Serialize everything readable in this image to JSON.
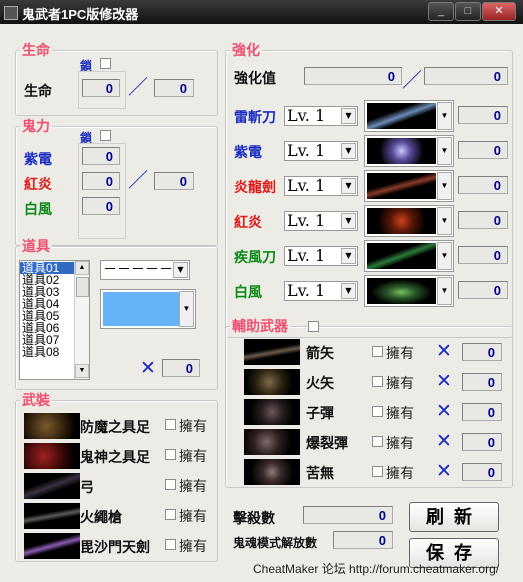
{
  "window": {
    "title": "鬼武者1PC版修改器",
    "min": "_",
    "max": "□",
    "close": "✕"
  },
  "life": {
    "group": "生命",
    "lock": "鎖",
    "label": "生命",
    "value": "0",
    "max_value": "0",
    "sep": "／"
  },
  "ki": {
    "group": "鬼力",
    "lock": "鎖",
    "purple": "紫電",
    "purple_value": "0",
    "red": "紅炎",
    "red_value": "0",
    "red_max": "0",
    "white": "白風",
    "white_value": "0",
    "sep": "／"
  },
  "items": {
    "group": "道具",
    "list": [
      "道具01",
      "道具02",
      "道具03",
      "道具04",
      "道具05",
      "道具06",
      "道具07",
      "道具08"
    ],
    "selected_index": 0,
    "dash_combo": "－－－－－",
    "times": "✕",
    "count": "0"
  },
  "armor": {
    "group": "武裝",
    "rows": [
      {
        "name": "防魔之具足",
        "owned": "擁有"
      },
      {
        "name": "鬼神之具足",
        "owned": "擁有"
      },
      {
        "name": "弓",
        "owned": "擁有"
      },
      {
        "name": "火繩槍",
        "owned": "擁有"
      },
      {
        "name": "毘沙門天劍",
        "owned": "擁有"
      }
    ]
  },
  "enhance": {
    "group": "強化",
    "label": "強化值",
    "value": "0",
    "max_value": "0",
    "sep": "／",
    "weapons": [
      {
        "name": "雷斬刀",
        "color": "#1a2dc0",
        "level": "Lv. 1",
        "value": "0"
      },
      {
        "name": "紫電",
        "color": "#1a2dc0",
        "level": "Lv. 1",
        "value": "0"
      },
      {
        "name": "炎龍劍",
        "color": "#e01818",
        "level": "Lv. 1",
        "value": "0"
      },
      {
        "name": "紅炎",
        "color": "#e01818",
        "level": "Lv. 1",
        "value": "0"
      },
      {
        "name": "疾風刀",
        "color": "#0c8a18",
        "level": "Lv. 1",
        "value": "0"
      },
      {
        "name": "白風",
        "color": "#0c8a18",
        "level": "Lv. 1",
        "value": "0"
      }
    ]
  },
  "aux": {
    "group": "輔助武器",
    "rows": [
      {
        "name": "箭矢",
        "owned": "擁有",
        "times": "✕",
        "value": "0"
      },
      {
        "name": "火矢",
        "owned": "擁有",
        "times": "✕",
        "value": "0"
      },
      {
        "name": "子彈",
        "owned": "擁有",
        "times": "✕",
        "value": "0"
      },
      {
        "name": "爆裂彈",
        "owned": "擁有",
        "times": "✕",
        "value": "0"
      },
      {
        "name": "苦無",
        "owned": "擁有",
        "times": "✕",
        "value": "0"
      }
    ]
  },
  "stats": {
    "kills_label": "擊殺數",
    "kills_value": "0",
    "unlock_label": "鬼魂模式解放數",
    "unlock_value": "0"
  },
  "buttons": {
    "refresh": "刷新",
    "save": "保存"
  },
  "status": "CheatMaker 论坛 http://forum.cheatmaker.org/"
}
